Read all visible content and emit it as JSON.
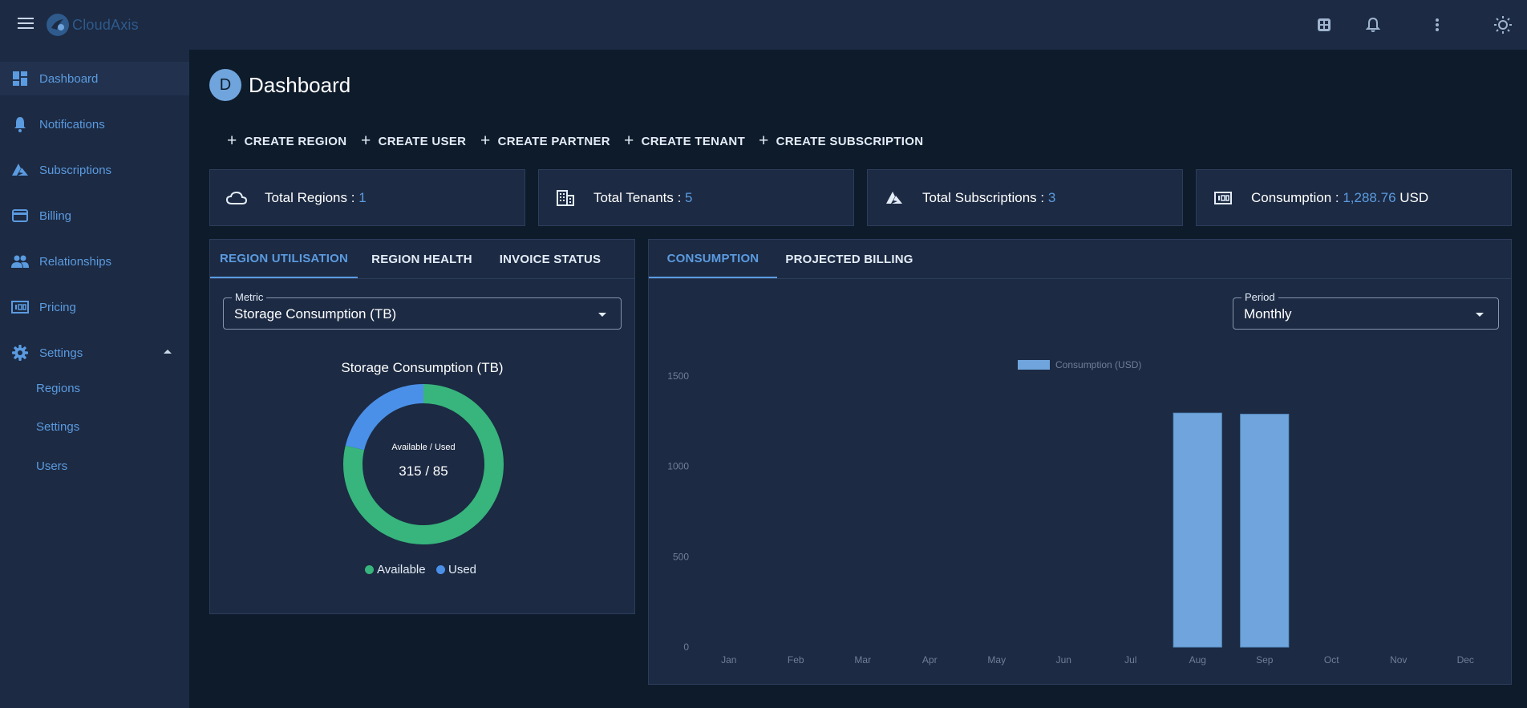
{
  "app": {
    "name": "CloudAxis"
  },
  "sidebar": {
    "items": [
      {
        "label": "Dashboard",
        "icon": "dashboard-icon"
      },
      {
        "label": "Notifications",
        "icon": "bell-icon"
      },
      {
        "label": "Subscriptions",
        "icon": "azure-icon"
      },
      {
        "label": "Billing",
        "icon": "credit-card-icon"
      },
      {
        "label": "Relationships",
        "icon": "people-icon"
      },
      {
        "label": "Pricing",
        "icon": "pricing-icon"
      },
      {
        "label": "Settings",
        "icon": "gear-icon"
      }
    ],
    "settings_children": [
      {
        "label": "Regions"
      },
      {
        "label": "Settings"
      },
      {
        "label": "Users"
      }
    ]
  },
  "page": {
    "avatar_letter": "D",
    "title": "Dashboard"
  },
  "actions": [
    {
      "label": "CREATE REGION"
    },
    {
      "label": "CREATE USER"
    },
    {
      "label": "CREATE PARTNER"
    },
    {
      "label": "CREATE TENANT"
    },
    {
      "label": "CREATE SUBSCRIPTION"
    }
  ],
  "actions_plus": "+",
  "cards": [
    {
      "label": "Total Regions : ",
      "value": "1",
      "suffix": "",
      "icon": "cloud-icon"
    },
    {
      "label": "Total Tenants : ",
      "value": "5",
      "suffix": "",
      "icon": "building-icon"
    },
    {
      "label": "Total Subscriptions : ",
      "value": "3",
      "suffix": "",
      "icon": "azure-icon"
    },
    {
      "label": "Consumption : ",
      "value": "1,288.76",
      "suffix": " USD",
      "icon": "pricing-icon"
    }
  ],
  "left_panel": {
    "tabs": [
      {
        "label": "REGION UTILISATION"
      },
      {
        "label": "REGION HEALTH"
      },
      {
        "label": "INVOICE STATUS"
      }
    ],
    "metric": {
      "legend": "Metric",
      "value": "Storage Consumption (TB)"
    },
    "donut": {
      "title": "Storage Consumption (TB)",
      "center_label": "Available / Used",
      "center_value": "315 / 85",
      "legend": [
        {
          "label": "Available"
        },
        {
          "label": "Used"
        }
      ]
    }
  },
  "right_panel": {
    "tabs": [
      {
        "label": "CONSUMPTION"
      },
      {
        "label": "PROJECTED BILLING"
      }
    ],
    "period": {
      "legend": "Period",
      "value": "Monthly"
    }
  },
  "colors": {
    "available": "#37b57c",
    "used": "#4a90e8",
    "bar": "#6fa5dc",
    "accent": "#5b9be0"
  },
  "chart_data": [
    {
      "type": "pie",
      "title": "Storage Consumption (TB)",
      "categories": [
        "Available",
        "Used"
      ],
      "values": [
        315,
        85
      ]
    },
    {
      "type": "bar",
      "categories": [
        "Jan",
        "Feb",
        "Mar",
        "Apr",
        "May",
        "Jun",
        "Jul",
        "Aug",
        "Sep",
        "Oct",
        "Nov",
        "Dec"
      ],
      "series": [
        {
          "name": "Consumption (USD)",
          "values": [
            0,
            0,
            0,
            0,
            0,
            0,
            0,
            1295,
            1288.76,
            0,
            0,
            0
          ]
        }
      ],
      "yticks": [
        0,
        500,
        1000,
        1500
      ],
      "ylim": [
        0,
        1500
      ],
      "grid": false,
      "legend": "top-center"
    }
  ]
}
